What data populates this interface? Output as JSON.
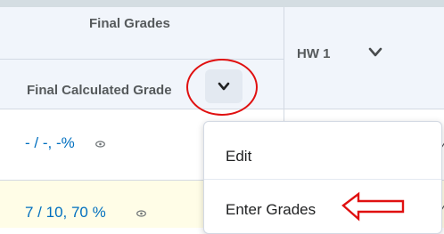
{
  "header": {
    "final_grades_title": "Final Grades",
    "final_calculated_label": "Final Calculated Grade",
    "hw_column_label": "HW 1"
  },
  "rows": [
    {
      "grade_value": "- / -, -%",
      "partial_percent": "%"
    },
    {
      "grade_value": "7 / 10, 70 %",
      "partial_percent": "%"
    }
  ],
  "context_menu": {
    "items": [
      {
        "label": "Edit"
      },
      {
        "label": "Enter Grades"
      }
    ]
  },
  "annotations": {
    "color": "#e01010"
  },
  "icons": [
    "chevron-down-icon",
    "eye-icon"
  ]
}
